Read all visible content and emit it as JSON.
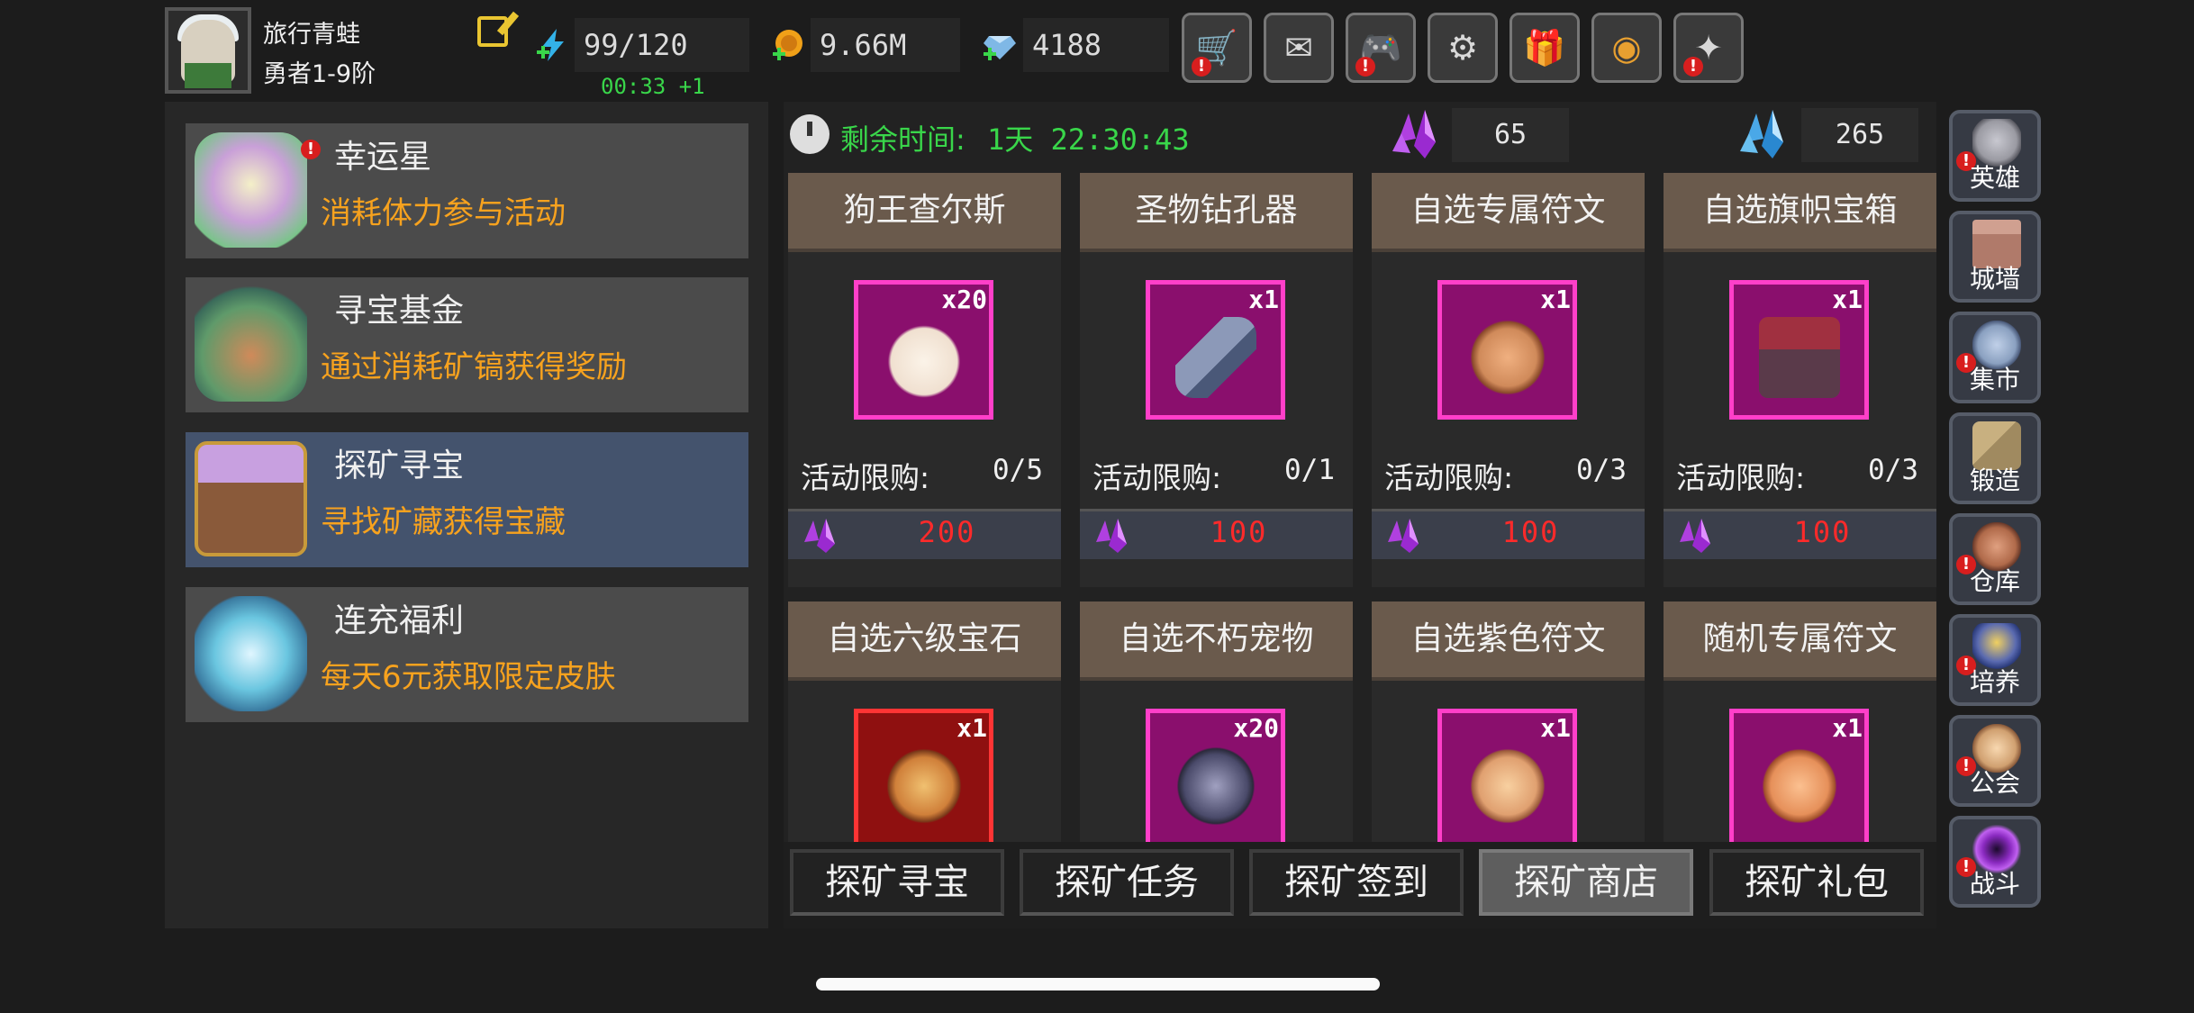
{
  "player": {
    "name": "旅行青蛙",
    "rank": "勇者1-9阶"
  },
  "resources": [
    {
      "id": "stamina",
      "value": "99/120",
      "icon": "lightning-plus-icon",
      "color": "#33b2e8"
    },
    {
      "id": "gold",
      "value": "9.66M",
      "icon": "gold-coin-plus-icon",
      "color": "#f0a018"
    },
    {
      "id": "diamond",
      "value": "4188",
      "icon": "diamond-plus-icon",
      "color": "#7fb8e6"
    }
  ],
  "stamina_timer": "00:33 +1",
  "top_buttons": [
    {
      "name": "shop-cart-button",
      "icon": "🛒",
      "alert": true
    },
    {
      "name": "mail-button",
      "icon": "✉",
      "alert": false
    },
    {
      "name": "gamepad-button",
      "icon": "🎮",
      "alert": true
    },
    {
      "name": "settings-button",
      "icon": "⚙",
      "alert": false
    },
    {
      "name": "gift-button",
      "icon": "🎁",
      "alert": false
    },
    {
      "name": "aperture-button",
      "icon": "◉",
      "alert": false
    },
    {
      "name": "fireworks-button",
      "icon": "✦",
      "alert": true
    }
  ],
  "events": [
    {
      "title": "幸运星",
      "desc": "消耗体力参与活动",
      "alert": true,
      "selected": false,
      "art": "#c9a0d8"
    },
    {
      "title": "寻宝基金",
      "desc": "通过消耗矿镐获得奖励",
      "alert": false,
      "selected": false,
      "art": "#5f9a6a"
    },
    {
      "title": "探矿寻宝",
      "desc": "寻找矿藏获得宝藏",
      "alert": false,
      "selected": true,
      "art": "#b07a4a"
    },
    {
      "title": "连充福利",
      "desc": "每天6元获取限定皮肤",
      "alert": false,
      "selected": false,
      "art": "#6ac6e0"
    }
  ],
  "shop": {
    "countdown_label": "剩余时间:",
    "countdown": "1天 22:30:43",
    "purple_crystals": "65",
    "blue_crystals": "265",
    "items": [
      {
        "name": "狗王查尔斯",
        "qty": "x20",
        "limit_label": "活动限购:",
        "limit": "0/5",
        "price": "200",
        "frame": "pink",
        "art": "#f0e0d0"
      },
      {
        "name": "圣物钻孔器",
        "qty": "x1",
        "limit_label": "活动限购:",
        "limit": "0/1",
        "price": "100",
        "frame": "pink",
        "art": "#8c99b8"
      },
      {
        "name": "自选专属符文",
        "qty": "x1",
        "limit_label": "活动限购:",
        "limit": "0/3",
        "price": "100",
        "frame": "pink",
        "art": "#d08a5a"
      },
      {
        "name": "自选旗帜宝箱",
        "qty": "x1",
        "limit_label": "活动限购:",
        "limit": "0/3",
        "price": "100",
        "frame": "pink",
        "art": "#7a4a5a"
      },
      {
        "name": "自选六级宝石",
        "qty": "x1",
        "frame": "red",
        "art": "#d0803a"
      },
      {
        "name": "自选不朽宠物",
        "qty": "x20",
        "frame": "pink",
        "art": "#4a4a6a"
      },
      {
        "name": "自选紫色符文",
        "qty": "x1",
        "frame": "pink",
        "art": "#e0a070"
      },
      {
        "name": "随机专属符文",
        "qty": "x1",
        "frame": "pink",
        "art": "#e6905a"
      }
    ]
  },
  "tabs": [
    {
      "label": "探矿寻宝",
      "active": false
    },
    {
      "label": "探矿任务",
      "active": false
    },
    {
      "label": "探矿签到",
      "active": false
    },
    {
      "label": "探矿商店",
      "active": true
    },
    {
      "label": "探矿礼包",
      "active": false
    }
  ],
  "side_menu": [
    {
      "label": "英雄",
      "alert": true,
      "art": "#9a9aa2"
    },
    {
      "label": "城墙",
      "alert": false,
      "art": "#b07a6a"
    },
    {
      "label": "集市",
      "alert": true,
      "art": "#8aa0c0"
    },
    {
      "label": "锻造",
      "alert": false,
      "art": "#a08a60"
    },
    {
      "label": "仓库",
      "alert": true,
      "art": "#b06a4a"
    },
    {
      "label": "培养",
      "alert": true,
      "art": "#5a6ab0"
    },
    {
      "label": "公会",
      "alert": true,
      "art": "#d0a070"
    },
    {
      "label": "战斗",
      "alert": true,
      "art": "#8a2ac0"
    }
  ]
}
